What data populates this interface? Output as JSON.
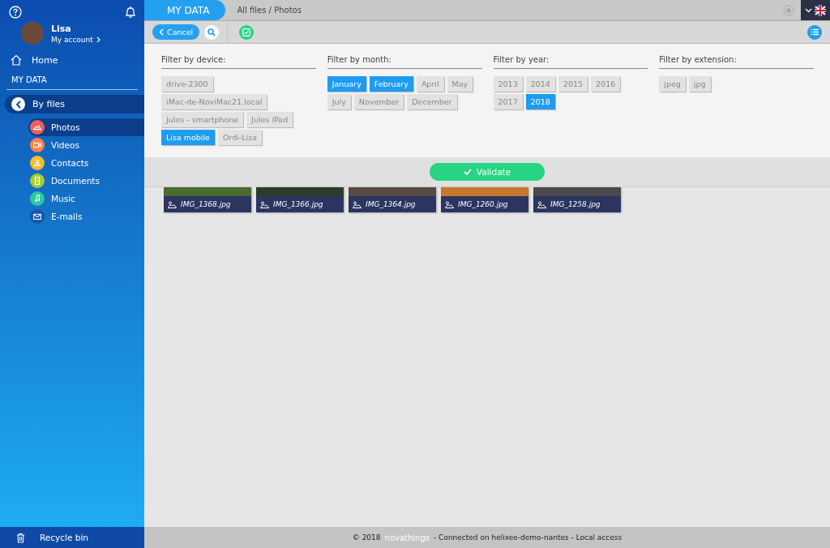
{
  "sidebar": {
    "user": {
      "name": "Lisa",
      "account_link": "My account"
    },
    "home": "Home",
    "section_title": "MY DATA",
    "by_files": "By files",
    "categories": [
      {
        "label": "Photos",
        "selected": true,
        "color": "#f0605a"
      },
      {
        "label": "Videos",
        "selected": false,
        "color": "#f7844a"
      },
      {
        "label": "Contacts",
        "selected": false,
        "color": "#f7bb2c"
      },
      {
        "label": "Documents",
        "selected": false,
        "color": "#a8cc2c"
      },
      {
        "label": "Music",
        "selected": false,
        "color": "#2cc9a0"
      },
      {
        "label": "E-mails",
        "selected": false,
        "color": "#1a54b0"
      }
    ],
    "recycle_bin": "Recycle bin"
  },
  "header": {
    "tab": "MY DATA",
    "breadcrumb": "All files / Photos"
  },
  "toolbar": {
    "cancel": "Cancel"
  },
  "filters": [
    {
      "title": "Filter by device:",
      "options": [
        {
          "label": "drive-2300",
          "selected": false
        },
        {
          "label": "iMac-de-NoviMac21.local",
          "selected": false
        },
        {
          "label": "Jules - smartphone",
          "selected": false
        },
        {
          "label": "Jules iPad",
          "selected": false
        },
        {
          "label": "Lisa mobile",
          "selected": true
        },
        {
          "label": "Ordi-Lisa",
          "selected": false
        }
      ]
    },
    {
      "title": "Filter by month:",
      "options": [
        {
          "label": "January",
          "selected": true
        },
        {
          "label": "February",
          "selected": true
        },
        {
          "label": "April",
          "selected": false
        },
        {
          "label": "May",
          "selected": false
        },
        {
          "label": "July",
          "selected": false
        },
        {
          "label": "November",
          "selected": false
        },
        {
          "label": "December",
          "selected": false
        }
      ]
    },
    {
      "title": "Filter by year:",
      "options": [
        {
          "label": "2013",
          "selected": false
        },
        {
          "label": "2014",
          "selected": false
        },
        {
          "label": "2015",
          "selected": false
        },
        {
          "label": "2016",
          "selected": false
        },
        {
          "label": "2017",
          "selected": false
        },
        {
          "label": "2018",
          "selected": true
        }
      ]
    },
    {
      "title": "Filter by extension:",
      "options": [
        {
          "label": "jpeg",
          "selected": false
        },
        {
          "label": "jpg",
          "selected": false
        }
      ]
    }
  ],
  "validate": "Validate",
  "photos": [
    {
      "name": "IMG_1368.jpg",
      "color": "#4a6a30"
    },
    {
      "name": "IMG_1366.jpg",
      "color": "#2e3a2a"
    },
    {
      "name": "IMG_1364.jpg",
      "color": "#5a4a44"
    },
    {
      "name": "IMG_1260.jpg",
      "color": "#c8782c"
    },
    {
      "name": "IMG_1258.jpg",
      "color": "#4a4a4e"
    }
  ],
  "footer": {
    "copyright": "© 2018",
    "brand": "novathings",
    "status": "- Connected on helixee-demo-nantes - Local access"
  }
}
